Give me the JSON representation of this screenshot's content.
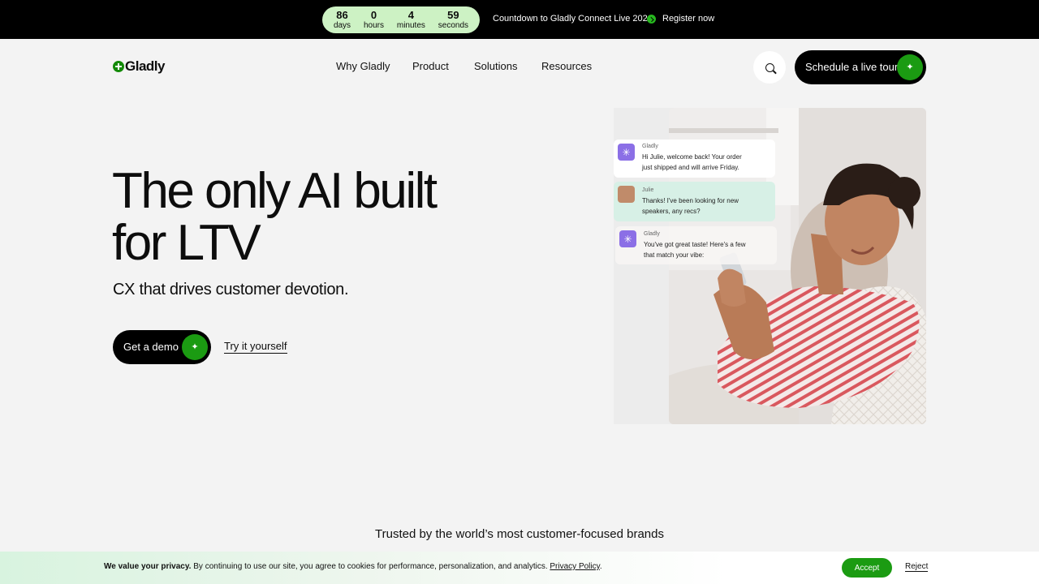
{
  "topbar": {
    "countdown": [
      {
        "value": "86",
        "label": "days"
      },
      {
        "value": "0",
        "label": "hours"
      },
      {
        "value": "4",
        "label": "minutes"
      },
      {
        "value": "59",
        "label": "seconds"
      }
    ],
    "announcement": "Countdown to Gladly Connect Live 2026",
    "register_label": "Register now"
  },
  "header": {
    "logo_text": "Gladly",
    "nav": [
      "Why Gladly",
      "Product",
      "Solutions",
      "Resources"
    ],
    "search_icon": "search-icon",
    "cta_label": "Schedule a live tour"
  },
  "hero": {
    "title_line1": "The only AI built",
    "title_line2": "for LTV",
    "subtitle": "CX that drives customer devotion.",
    "demo_label": "Get a demo",
    "try_label": "Try it yourself"
  },
  "chat": [
    {
      "name": "Gladly",
      "text_line1": "Hi Julie, welcome back! Your order",
      "text_line2": "just shipped and will arrive Friday."
    },
    {
      "name": "Julie",
      "text_line1": "Thanks! I've been looking for new",
      "text_line2": "speakers, any recs?"
    },
    {
      "name": "Gladly",
      "text_line1": "You've got great taste! Here's a few",
      "text_line2": "that match your vibe:"
    }
  ],
  "trusted": "Trusted by the world’s most customer-focused brands",
  "cookie": {
    "bold": "We value your privacy.",
    "text": " By continuing to use our site, you agree to cookies for performance, personalization, and analytics. ",
    "policy_link": "Privacy Policy",
    "end": ".",
    "accept_label": "Accept",
    "reject_label": "Reject"
  },
  "colors": {
    "brand_green": "#1b9b12",
    "countdown_bg": "#cdf2c4",
    "chat_purple": "#8b6fe6",
    "chat_mint": "#d7f0e6"
  }
}
